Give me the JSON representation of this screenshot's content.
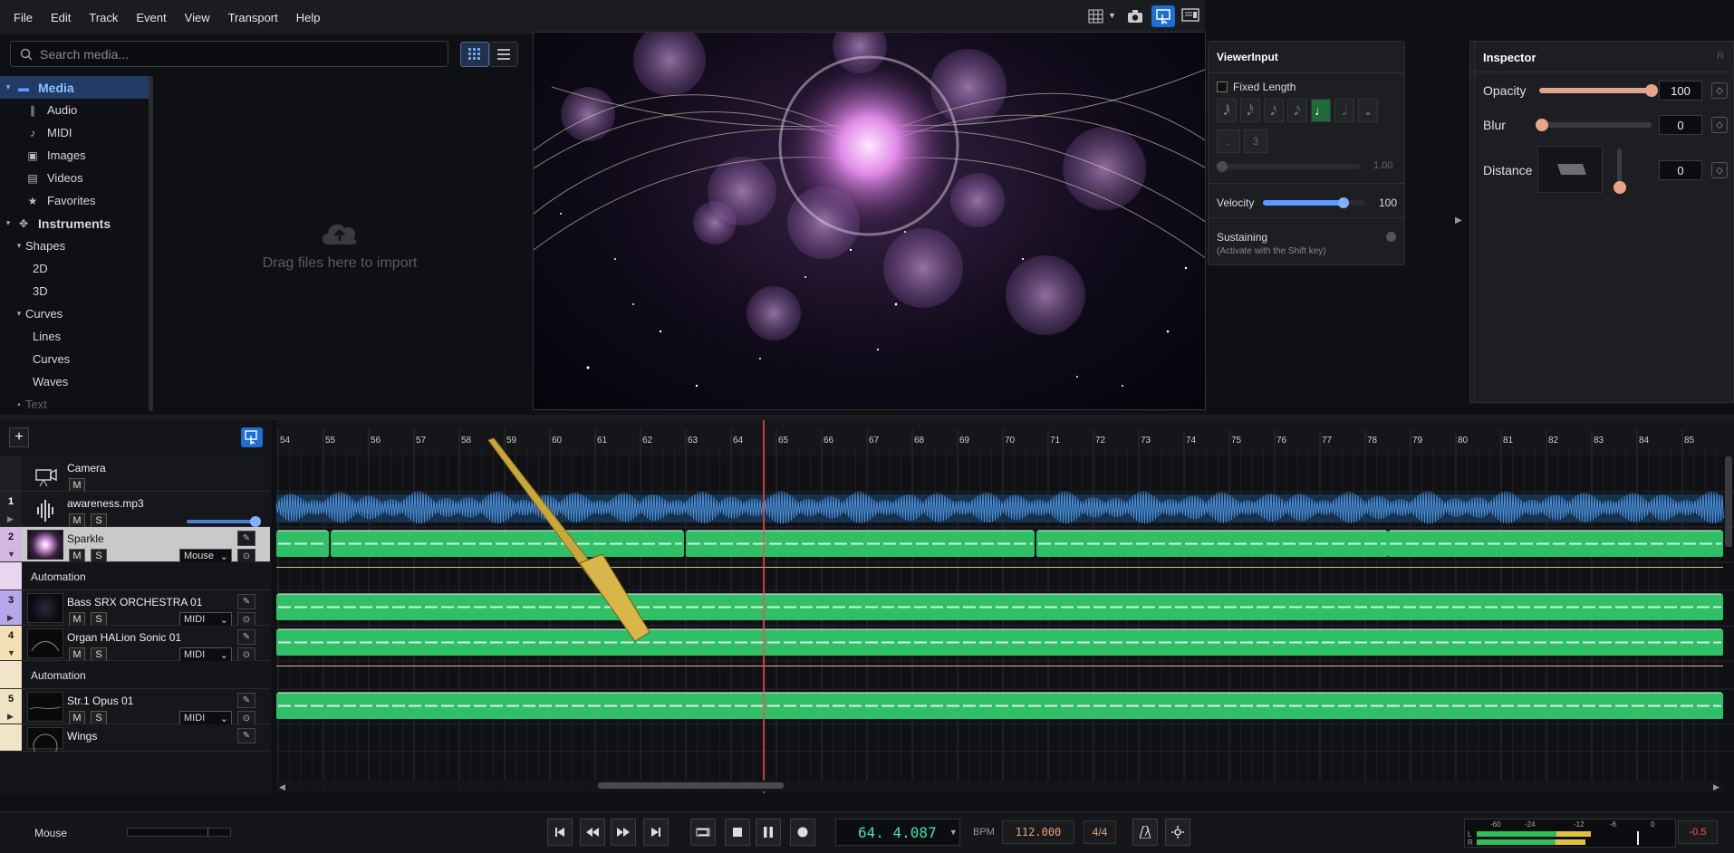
{
  "menu": [
    "File",
    "Edit",
    "Track",
    "Event",
    "View",
    "Transport",
    "Help"
  ],
  "search": {
    "placeholder": "Search media..."
  },
  "tree": [
    {
      "label": "Media",
      "level": 0,
      "expanded": true,
      "selected": true,
      "bold": true
    },
    {
      "label": "Audio",
      "level": 1
    },
    {
      "label": "MIDI",
      "level": 1
    },
    {
      "label": "Images",
      "level": 1
    },
    {
      "label": "Videos",
      "level": 1
    },
    {
      "label": "Favorites",
      "level": 1
    },
    {
      "label": "Instruments",
      "level": 0,
      "expanded": true,
      "bold": true
    },
    {
      "label": "Shapes",
      "level": 1,
      "expanded": true
    },
    {
      "label": "2D",
      "level": 2
    },
    {
      "label": "3D",
      "level": 2
    },
    {
      "label": "Curves",
      "level": 1,
      "expanded": true
    },
    {
      "label": "Lines",
      "level": 2
    },
    {
      "label": "Curves",
      "level": 2
    },
    {
      "label": "Waves",
      "level": 2
    },
    {
      "label": "Text",
      "level": 1
    }
  ],
  "dropzone": {
    "text": "Drag files here to import"
  },
  "viewer_input": {
    "title": "ViewerInput",
    "fixed_length": "Fixed Length",
    "length_value": "1.00",
    "triplet": "3",
    "dot": ".",
    "velocity_label": "Velocity",
    "velocity_value": "100",
    "velocity_level": 0.79,
    "sustaining": "Sustaining",
    "sustaining_hint": "(Activate with the Shift key)"
  },
  "inspector": {
    "title": "Inspector",
    "corner": "R",
    "opacity_label": "Opacity",
    "opacity_value": "100",
    "opacity_level": 1.0,
    "blur_label": "Blur",
    "blur_value": "0",
    "blur_level": 0,
    "distance_label": "Distance",
    "distance_value": "0"
  },
  "ruler": [
    "54",
    "55",
    "56",
    "57",
    "58",
    "59",
    "60",
    "61",
    "62",
    "63",
    "64",
    "65",
    "66",
    "67",
    "68",
    "69",
    "70",
    "71",
    "72",
    "73",
    "74",
    "75",
    "76",
    "77",
    "78",
    "79",
    "80",
    "81",
    "82",
    "83",
    "84",
    "85"
  ],
  "tracks": [
    {
      "num": "",
      "name": "Camera",
      "type": "camera"
    },
    {
      "num": "1",
      "name": "awareness.mp3",
      "type": "audio"
    },
    {
      "num": "2",
      "name": "Sparkle",
      "type": "inst",
      "selector": "Mouse",
      "selected": true
    },
    {
      "num": "",
      "name": "Automation",
      "type": "auto"
    },
    {
      "num": "3",
      "name": "Bass SRX ORCHESTRA 01",
      "type": "inst",
      "selector": "MIDI"
    },
    {
      "num": "4",
      "name": "Organ HALion Sonic 01",
      "type": "inst",
      "selector": "MIDI"
    },
    {
      "num": "",
      "name": "Automation",
      "type": "auto"
    },
    {
      "num": "5",
      "name": "Str.1 Opus 01",
      "type": "inst",
      "selector": "MIDI"
    },
    {
      "num": "",
      "name": "Wings",
      "type": "inst",
      "selector": ""
    }
  ],
  "labels": {
    "mute": "M",
    "solo": "S"
  },
  "transport": {
    "input_label": "Mouse",
    "position": "64. 4.087",
    "bpm_label": "BPM",
    "bpm": "112.000",
    "signature": "4/4",
    "meter_scale": [
      "-60",
      "-24",
      "-12",
      "-6",
      "0"
    ],
    "meter_L": "L",
    "meter_R": "R",
    "peak": "-0.5"
  }
}
